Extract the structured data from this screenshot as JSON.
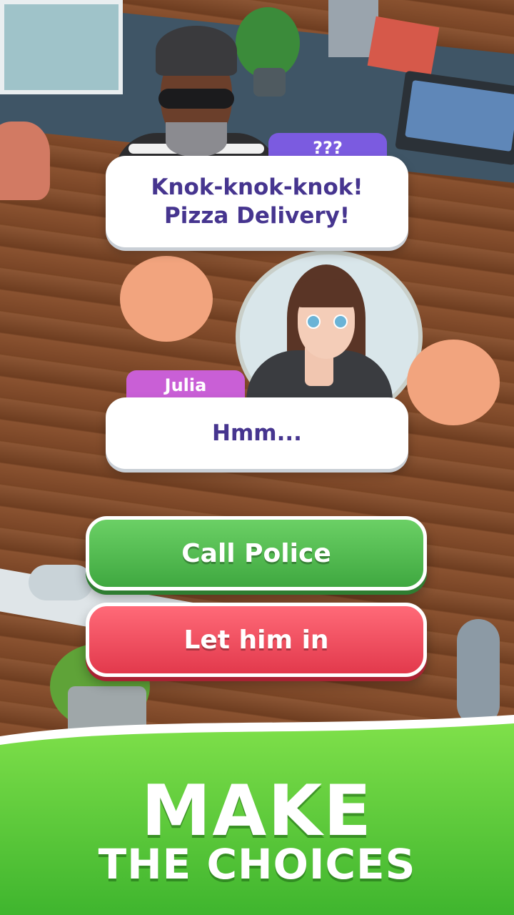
{
  "dialogue": {
    "speaker_1": {
      "name": "???",
      "line_1": "Knok-knok-knok!",
      "line_2": "Pizza Delivery!"
    },
    "speaker_2": {
      "name": "Julia",
      "line": "Hmm..."
    }
  },
  "choices": {
    "option_1": "Call Police",
    "option_2": "Let him in"
  },
  "banner": {
    "line_1": "MAKE",
    "line_2": "THE CHOICES"
  },
  "colors": {
    "dialogue_text": "#46358f",
    "unknown_tag": "#7b5be0",
    "julia_tag": "#c95fd6",
    "green_button": "#4cb84a",
    "red_button": "#ef4a5c",
    "banner_green": "#4fc33a"
  }
}
